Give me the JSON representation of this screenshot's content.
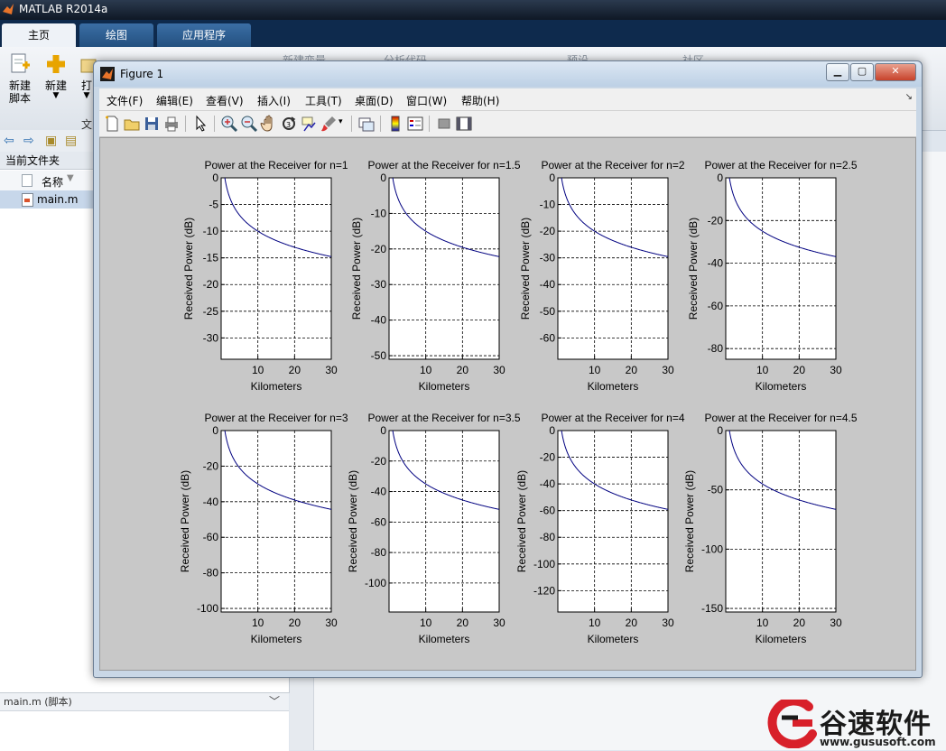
{
  "app": {
    "title": "MATLAB R2014a"
  },
  "ribbon": {
    "tabs": [
      "主页",
      "绘图",
      "应用程序"
    ],
    "buttons": [
      {
        "label": "新建\n脚本",
        "icon": "new-script-icon"
      },
      {
        "label": "新建",
        "icon": "new-icon"
      },
      {
        "label": "打",
        "icon": "open-icon"
      }
    ],
    "ghost_text": [
      "新建变量",
      "分析代码",
      "预设",
      "社区",
      "文"
    ]
  },
  "file_browser": {
    "header": "当前文件夹",
    "column_name": "名称",
    "files": [
      "main.m"
    ]
  },
  "details": {
    "header": "main.m (脚本)"
  },
  "figure": {
    "title": "Figure 1",
    "menu": [
      "文件(F)",
      "编辑(E)",
      "查看(V)",
      "插入(I)",
      "工具(T)",
      "桌面(D)",
      "窗口(W)",
      "帮助(H)"
    ],
    "toolbar_icons": [
      "new-figure-icon",
      "open-file-icon",
      "save-icon",
      "print-icon",
      "pointer-icon",
      "zoom-in-icon",
      "zoom-out-icon",
      "pan-icon",
      "rotate-icon",
      "data-cursor-icon",
      "brush-icon",
      "link-icon",
      "colorbar-icon",
      "legend-icon",
      "hide-plot-tools-icon",
      "show-plot-tools-icon"
    ]
  },
  "chart_data": {
    "type": "line",
    "layout": "2x4 subplots",
    "xlabel": "Kilometers",
    "ylabel": "Received Power (dB)",
    "xlim": [
      0,
      30
    ],
    "xticks": [
      10,
      20,
      30
    ],
    "grid": true,
    "line_color": "#000080",
    "model": "y = -10*n*log10(x) sampled from x=1 to x=30 km",
    "subplots": [
      {
        "title": "Power at the Receiver for n=1",
        "n": 1,
        "ylim": [
          -34,
          0
        ],
        "yticks": [
          0,
          -5,
          -10,
          -15,
          -20,
          -25,
          -30
        ]
      },
      {
        "title": "Power at the Receiver for n=1.5",
        "n": 1.5,
        "ylim": [
          -51,
          0
        ],
        "yticks": [
          0,
          -10,
          -20,
          -30,
          -40,
          -50
        ]
      },
      {
        "title": "Power at the Receiver for n=2",
        "n": 2,
        "ylim": [
          -68,
          0
        ],
        "yticks": [
          0,
          -10,
          -20,
          -30,
          -40,
          -50,
          -60
        ]
      },
      {
        "title": "Power at the Receiver for n=2.5",
        "n": 2.5,
        "ylim": [
          -85,
          0
        ],
        "yticks": [
          0,
          -20,
          -40,
          -60,
          -80
        ]
      },
      {
        "title": "Power at the Receiver for n=3",
        "n": 3,
        "ylim": [
          -102,
          0
        ],
        "yticks": [
          0,
          -20,
          -40,
          -60,
          -80,
          -100
        ]
      },
      {
        "title": "Power at the Receiver for n=3.5",
        "n": 3.5,
        "ylim": [
          -119,
          0
        ],
        "yticks": [
          0,
          -20,
          -40,
          -60,
          -80,
          -100
        ]
      },
      {
        "title": "Power at the Receiver for n=4",
        "n": 4,
        "ylim": [
          -136,
          0
        ],
        "yticks": [
          0,
          -20,
          -40,
          -60,
          -80,
          -100,
          -120
        ]
      },
      {
        "title": "Power at the Receiver for n=4.5",
        "n": 4.5,
        "ylim": [
          -153,
          0
        ],
        "yticks": [
          0,
          -50,
          -100,
          -150
        ]
      }
    ]
  },
  "watermark": {
    "text": "谷速软件",
    "url": "www.gususoft.com"
  }
}
